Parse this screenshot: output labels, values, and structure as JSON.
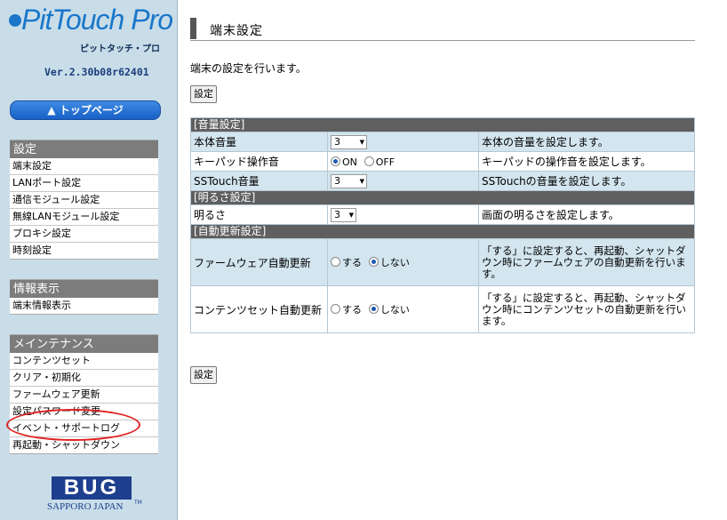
{
  "sidebar": {
    "logo_text": "PitTouch Pro",
    "logo_subtitle": "ピットタッチ・プロ",
    "version": "Ver.2.30b08r62401",
    "top_button": "▲ トップページ",
    "sections": [
      {
        "title": "設定",
        "items": [
          "端末設定",
          "LANポート設定",
          "通信モジュール設定",
          "無線LANモジュール設定",
          "プロキシ設定",
          "時刻設定"
        ]
      },
      {
        "title": "情報表示",
        "items": [
          "端末情報表示"
        ]
      },
      {
        "title": "メインテナンス",
        "items": [
          "コンテンツセット",
          "クリア・初期化",
          "ファームウェア更新",
          "設定パスワード変更",
          "イベント・サポートログ",
          "再起動・シャットダウン"
        ]
      }
    ],
    "company_logo": "BUG",
    "company_sub": "SAPPORO JAPAN",
    "tm": "TM"
  },
  "main": {
    "title": "端末設定",
    "description": "端末の設定を行います。",
    "set_button": "設定",
    "sections": {
      "volume": "[音量設定]",
      "brightness": "[明るさ設定]",
      "autoupdate": "[自動更新設定]"
    },
    "rows": {
      "body_volume": {
        "label": "本体音量",
        "value": "3",
        "note": "本体の音量を設定します。"
      },
      "keypad_sound": {
        "label": "キーパッド操作音",
        "on": "ON",
        "off": "OFF",
        "note": "キーパッドの操作音を設定します。"
      },
      "sstouch_volume": {
        "label": "SSTouch音量",
        "value": "3",
        "note": "SSTouchの音量を設定します。"
      },
      "brightness": {
        "label": "明るさ",
        "value": "3",
        "note": "画面の明るさを設定します。"
      },
      "firmware_auto": {
        "label": "ファームウェア自動更新",
        "yes": "する",
        "no": "しない",
        "note": "「する」に設定すると、再起動、シャットダウン時にファームウェアの自動更新を行います。"
      },
      "contents_auto": {
        "label": "コンテンツセット自動更新",
        "yes": "する",
        "no": "しない",
        "note": "「する」に設定すると、再起動、シャットダウン時にコンテンツセットの自動更新を行います。"
      }
    }
  },
  "colors": {
    "sidebar_bg": "#c9dde9",
    "accent_blue": "#1a77c9",
    "highlight": "#e02020"
  }
}
